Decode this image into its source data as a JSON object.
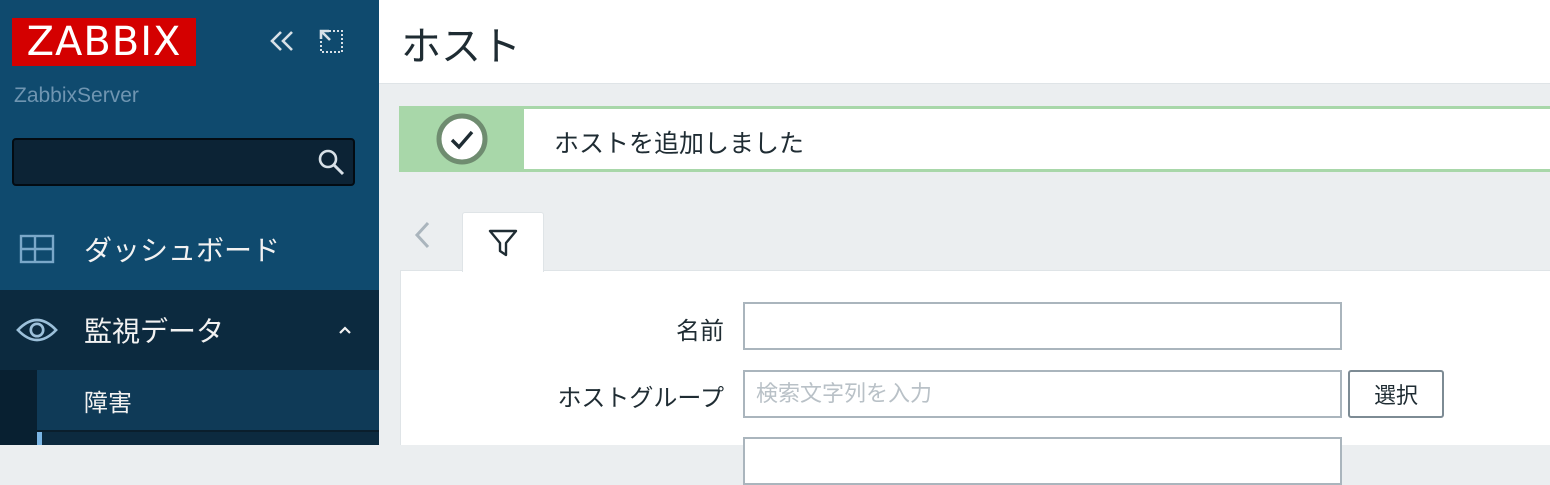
{
  "sidebar": {
    "logo": "ZABBIX",
    "server_name": "ZabbixServer",
    "search": {
      "value": "",
      "placeholder": ""
    },
    "controls": {
      "collapse_icon": "double-chevron-left-icon",
      "kiosk_icon": "expand-icon"
    },
    "menu": [
      {
        "label": "ダッシュボード",
        "icon": "dashboard-icon",
        "expanded": false
      },
      {
        "label": "監視データ",
        "icon": "eye-icon",
        "expanded": true,
        "children": [
          {
            "label": "障害"
          }
        ]
      }
    ]
  },
  "header": {
    "title": "ホスト"
  },
  "message": {
    "text": "ホストを追加しました",
    "type": "success",
    "icon": "check-circle-icon"
  },
  "filter": {
    "tab_icon": "funnel-icon",
    "fields": [
      {
        "label": "名前",
        "value": "",
        "placeholder": ""
      },
      {
        "label": "ホストグループ",
        "value": "",
        "placeholder": "検索文字列を入力"
      }
    ],
    "select_button": "選択"
  },
  "colors": {
    "sidebar_bg": "#0f4a6e",
    "logo_red": "#d40000",
    "success_green": "#a8d7a9",
    "page_bg": "#ebeef0"
  }
}
